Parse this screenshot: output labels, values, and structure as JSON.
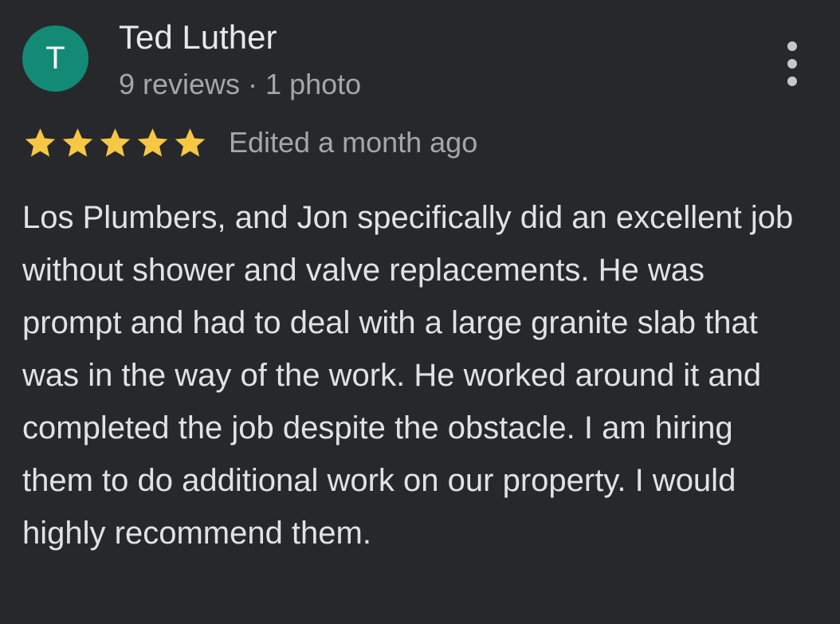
{
  "review": {
    "author": {
      "initial": "T",
      "name": "Ted Luther",
      "meta": "9 reviews · 1 photo"
    },
    "rating": {
      "stars": 5,
      "max_stars": 5
    },
    "edited": "Edited a month ago",
    "text": "Los Plumbers, and Jon specifically did an excellent job without shower and valve replacements. He was prompt and had to deal with a large granite slab that was in the way of the work. He worked around it and completed the job despite the obstacle. I am hiring them to do additional work on our property. I would highly recommend them."
  },
  "icons": {
    "more": "more-vert-icon",
    "star": "star-icon"
  },
  "colors": {
    "background": "#27282b",
    "avatar": "#138a76",
    "star": "#f6c744",
    "primary_text": "#e6e6e6",
    "secondary_text": "#a6a6a8"
  }
}
